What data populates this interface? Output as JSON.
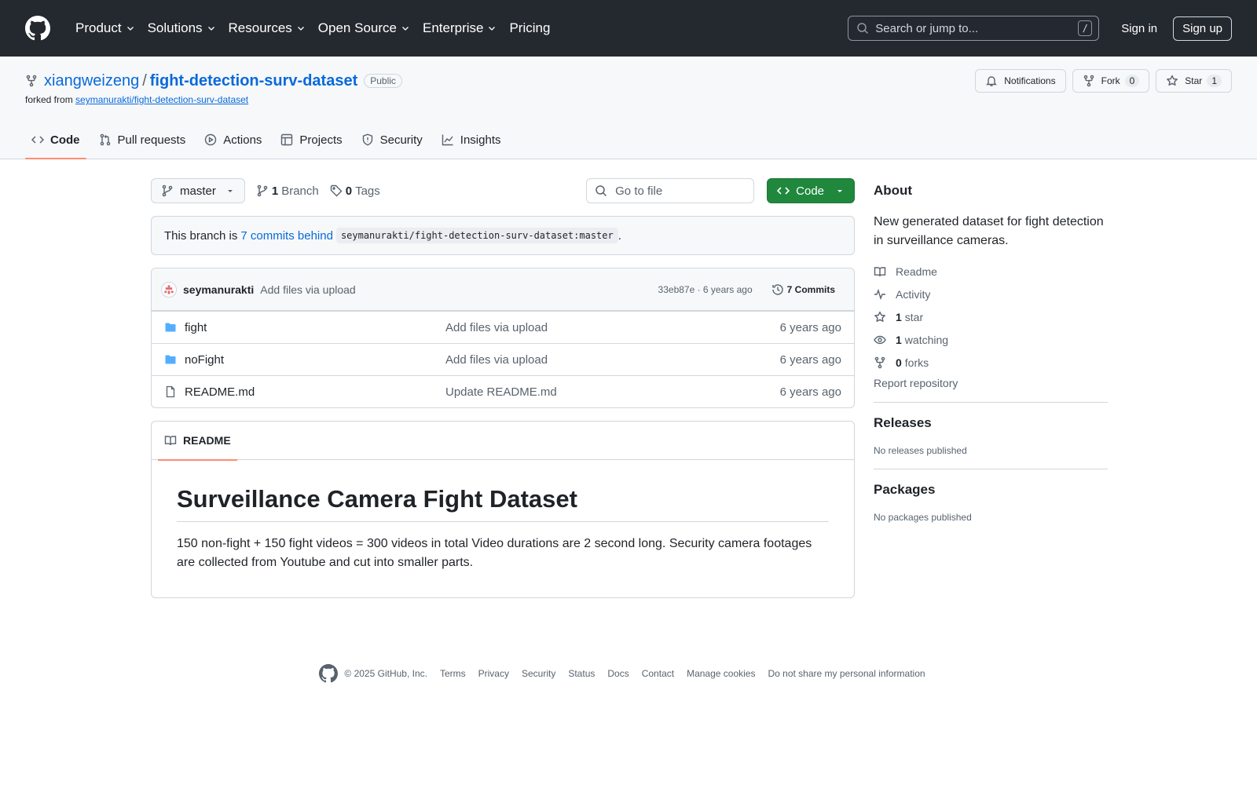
{
  "header": {
    "nav": [
      "Product",
      "Solutions",
      "Resources",
      "Open Source",
      "Enterprise",
      "Pricing"
    ],
    "search_placeholder": "Search or jump to...",
    "search_shortcut": "/",
    "sign_in": "Sign in",
    "sign_up": "Sign up"
  },
  "repo": {
    "owner": "xiangweizeng",
    "separator": "/",
    "name": "fight-detection-surv-dataset",
    "visibility": "Public",
    "forked_from_label": "forked from",
    "forked_from": "seymanurakti/fight-detection-surv-dataset",
    "notifications_label": "Notifications",
    "fork_label": "Fork",
    "fork_count": "0",
    "star_label": "Star",
    "star_count": "1"
  },
  "tabs": [
    "Code",
    "Pull requests",
    "Actions",
    "Projects",
    "Security",
    "Insights"
  ],
  "toolbar": {
    "branch": "master",
    "branch_count": "1",
    "branch_label": "Branch",
    "tag_count": "0",
    "tag_label": "Tags",
    "goto_file": "Go to file",
    "code_button": "Code"
  },
  "behind": {
    "prefix": "This branch is",
    "link": "7 commits behind",
    "ref": "seymanurakti/fight-detection-surv-dataset:master",
    "suffix": "."
  },
  "latest_commit": {
    "author": "seymanurakti",
    "message": "Add files via upload",
    "meta": "33eb87e · 6 years ago",
    "commits_label": "7 Commits"
  },
  "files": [
    {
      "type": "dir",
      "name": "fight",
      "message": "Add files via upload",
      "time": "6 years ago"
    },
    {
      "type": "dir",
      "name": "noFight",
      "message": "Add files via upload",
      "time": "6 years ago"
    },
    {
      "type": "file",
      "name": "README.md",
      "message": "Update README.md",
      "time": "6 years ago"
    }
  ],
  "readme": {
    "tab_label": "README",
    "title": "Surveillance Camera Fight Dataset",
    "body": "150 non-fight + 150 fight videos = 300 videos in total Video durations are 2 second long. Security camera footages are collected from Youtube and cut into smaller parts."
  },
  "about": {
    "heading": "About",
    "description": "New generated dataset for fight detection in surveillance cameras.",
    "readme": "Readme",
    "activity": "Activity",
    "stars_count": "1",
    "stars_label": "star",
    "watching_count": "1",
    "watching_label": "watching",
    "forks_count": "0",
    "forks_label": "forks",
    "report": "Report repository"
  },
  "releases": {
    "heading": "Releases",
    "empty": "No releases published"
  },
  "packages": {
    "heading": "Packages",
    "empty": "No packages published"
  },
  "footer": {
    "copyright": "© 2025 GitHub, Inc.",
    "links": [
      "Terms",
      "Privacy",
      "Security",
      "Status",
      "Docs",
      "Contact",
      "Manage cookies",
      "Do not share my personal information"
    ]
  },
  "colors": {
    "header_bg": "#24292f",
    "link": "#0969da",
    "code_button": "#1f883d",
    "tab_underline": "#fd8c73",
    "folder": "#54aeff"
  }
}
